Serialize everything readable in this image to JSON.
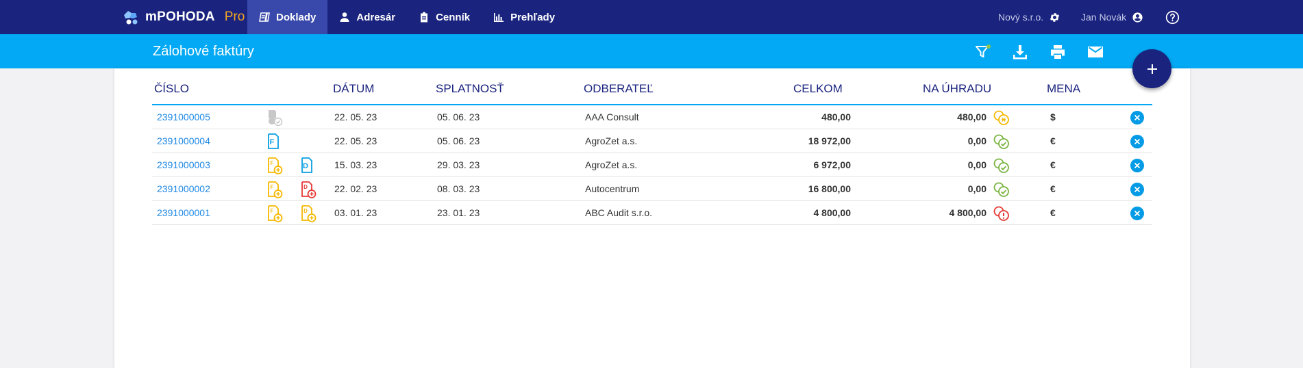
{
  "brand": {
    "name": "mPOHODA",
    "edition": "Pro"
  },
  "nav": [
    {
      "label": "Doklady",
      "icon": "documents-icon",
      "active": true
    },
    {
      "label": "Adresár",
      "icon": "person-icon",
      "active": false
    },
    {
      "label": "Cenník",
      "icon": "clipboard-icon",
      "active": false
    },
    {
      "label": "Prehľady",
      "icon": "bar-chart-icon",
      "active": false
    }
  ],
  "company": {
    "name": "Nový s.r.o."
  },
  "user": {
    "name": "Jan Novák"
  },
  "page": {
    "title": "Zálohové faktúry"
  },
  "table": {
    "headers": {
      "number": "ČÍSLO",
      "date": "DÁTUM",
      "due": "SPLATNOSŤ",
      "customer": "ODBERATEĽ",
      "total": "CELKOM",
      "to_pay": "NA ÚHRADU",
      "currency": "MENA"
    },
    "rows": [
      {
        "number": "2391000005",
        "date": "22. 05. 23",
        "due": "05. 06. 23",
        "customer": "AAA Consult",
        "total": "480,00",
        "to_pay": "480,00",
        "currency": "$",
        "doc1": "F",
        "doc1_status": "pending",
        "doc2": "",
        "doc2_status": "",
        "pay_status": "partial"
      },
      {
        "number": "2391000004",
        "date": "22. 05. 23",
        "due": "05. 06. 23",
        "customer": "AgroZet a.s.",
        "total": "18 972,00",
        "to_pay": "0,00",
        "currency": "€",
        "doc1": "F",
        "doc1_status": "blue",
        "doc2": "",
        "doc2_status": "",
        "pay_status": "paid"
      },
      {
        "number": "2391000003",
        "date": "15. 03. 23",
        "due": "29. 03. 23",
        "customer": "AgroZet a.s.",
        "total": "6 972,00",
        "to_pay": "0,00",
        "currency": "€",
        "doc1": "F",
        "doc1_status": "yellow",
        "doc2": "D",
        "doc2_status": "blue",
        "pay_status": "paid"
      },
      {
        "number": "2391000002",
        "date": "22. 02. 23",
        "due": "08. 03. 23",
        "customer": "Autocentrum",
        "total": "16 800,00",
        "to_pay": "0,00",
        "currency": "€",
        "doc1": "F",
        "doc1_status": "yellow",
        "doc2": "D",
        "doc2_status": "red",
        "pay_status": "paid"
      },
      {
        "number": "2391000001",
        "date": "03. 01. 23",
        "due": "23. 01. 23",
        "customer": "ABC Audit s.r.o.",
        "total": "4 800,00",
        "to_pay": "4 800,00",
        "currency": "€",
        "doc1": "F",
        "doc1_status": "yellow",
        "doc2": "D",
        "doc2_status": "yellow",
        "pay_status": "overdue"
      }
    ]
  },
  "colors": {
    "nav_bg": "#1a237e",
    "nav_active": "#3949ab",
    "subbar_bg": "#03a9f4",
    "link": "#1e88e5",
    "yellow": "#f5b800",
    "blue": "#0a9fe0",
    "red": "#e53935",
    "green": "#7cb342",
    "grey": "#c8c8c8"
  }
}
